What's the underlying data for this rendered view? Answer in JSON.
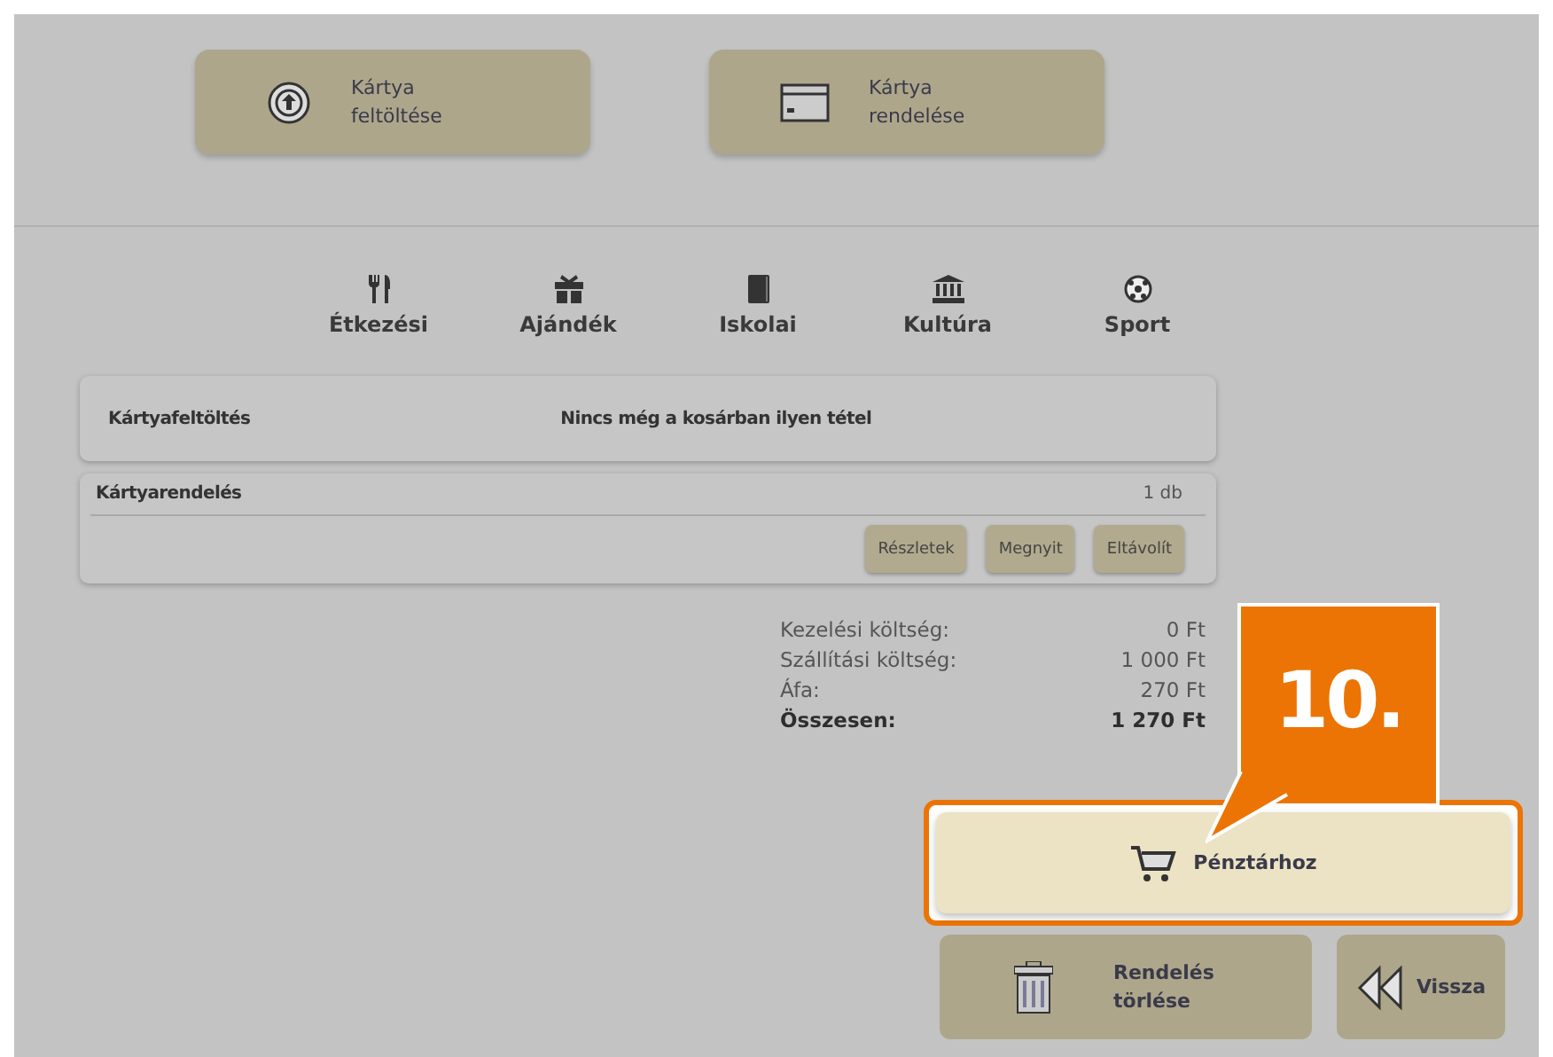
{
  "top_buttons": [
    {
      "label": "Kártya feltöltése"
    },
    {
      "label": "Kártya rendelése"
    }
  ],
  "categories": [
    {
      "label": "Étkezési"
    },
    {
      "label": "Ajándék"
    },
    {
      "label": "Iskolai"
    },
    {
      "label": "Kultúra"
    },
    {
      "label": "Sport"
    }
  ],
  "cart_sections": [
    {
      "kind": "empty",
      "title": "Kártyafeltöltés",
      "message": "Nincs még a kosárban ilyen tétel"
    },
    {
      "kind": "items",
      "title": "Kártyarendelés",
      "count": "1 db",
      "actions": [
        "Részletek",
        "Megnyit",
        "Eltávolít"
      ]
    }
  ],
  "totals": [
    {
      "label": "Kezelési költség:",
      "value": "0 Ft",
      "emphasized": false
    },
    {
      "label": "Szállítási költség:",
      "value": "1 000 Ft",
      "emphasized": false
    },
    {
      "label": "Áfa:",
      "value": "270 Ft",
      "emphasized": false
    },
    {
      "label": "Összesen:",
      "value": "1 270 Ft",
      "emphasized": true
    }
  ],
  "checkout_button": {
    "label": "Pénztárhoz",
    "highlighted": true
  },
  "bottom_buttons": [
    {
      "label": "Rendelés törlése"
    },
    {
      "label": "Vissza"
    }
  ],
  "callout": {
    "text": "10."
  }
}
